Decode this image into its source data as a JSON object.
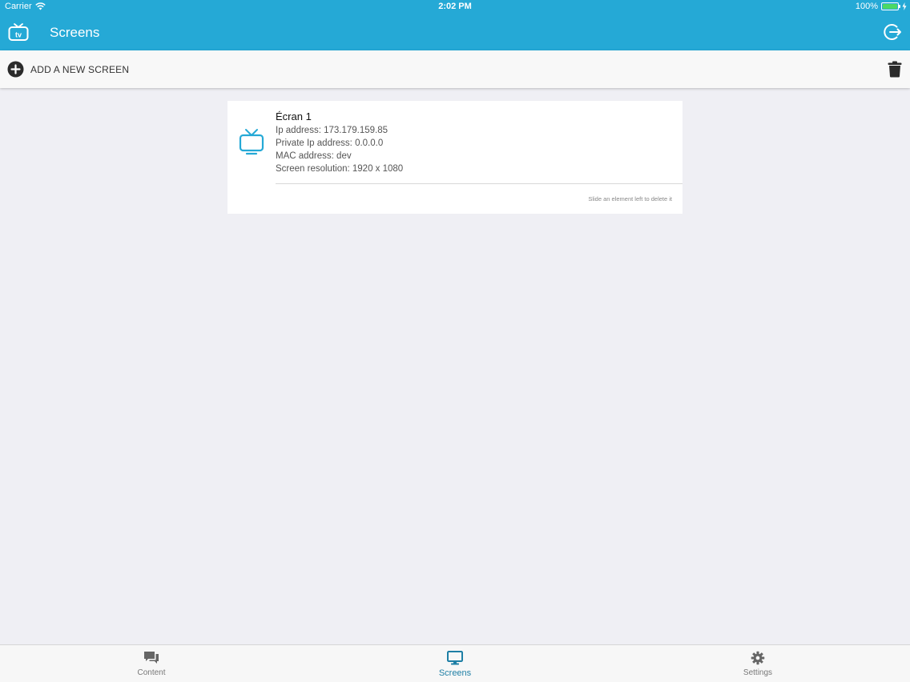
{
  "status_bar": {
    "carrier": "Carrier",
    "time": "2:02 PM",
    "battery_label": "100%",
    "battery_level": 1.0,
    "wifi_icon": "wifi-icon",
    "charging_icon": "charging-icon"
  },
  "nav": {
    "title": "Screens",
    "logo_icon": "tv-logo-icon",
    "logout_icon": "logout-icon"
  },
  "toolbar": {
    "add_label": "ADD A NEW SCREEN",
    "add_icon": "plus-circle-icon",
    "delete_icon": "trash-icon"
  },
  "screens": [
    {
      "name": "Écran 1",
      "ip_line": "Ip address: 173.179.159.85",
      "private_ip_line": "Private Ip address: 0.0.0.0",
      "mac_line": "MAC address: dev",
      "resolution_line": "Screen resolution: 1920 x 1080",
      "icon": "tv-icon"
    }
  ],
  "hint": "Slide an element left to delete it",
  "tabs": [
    {
      "label": "Content",
      "icon": "chat-icon",
      "active": false
    },
    {
      "label": "Screens",
      "icon": "monitor-icon",
      "active": true
    },
    {
      "label": "Settings",
      "icon": "gear-icon",
      "active": false
    }
  ],
  "colors": {
    "accent": "#25a9d6",
    "active_tab": "#1e7fa5",
    "background": "#efeff4"
  }
}
